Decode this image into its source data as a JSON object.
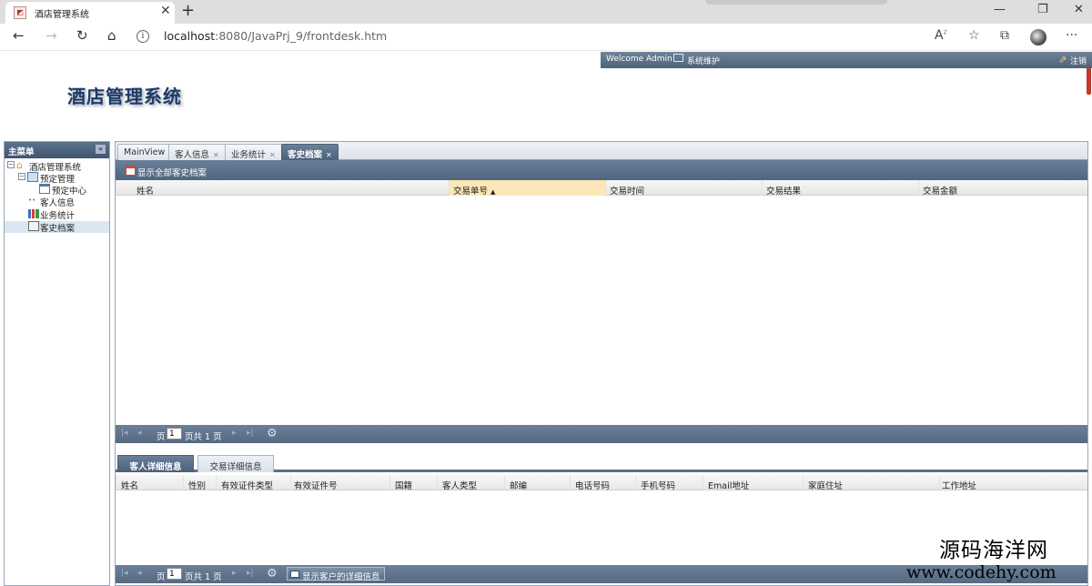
{
  "browser": {
    "tab_title": "酒店管理系统",
    "tab_close": "✕",
    "new_tab": "+",
    "url_host": "localhost",
    "url_path": ":8080/JavaPrj_9/frontdesk.htm",
    "more": "···"
  },
  "header": {
    "welcome": "Welcome Admin",
    "maintenance": "系统维护",
    "logout": "注销",
    "app_title": "酒店管理系统"
  },
  "sidebar": {
    "title": "主菜单",
    "items": [
      {
        "label": "酒店管理系统"
      },
      {
        "label": "预定管理"
      },
      {
        "label": "预定中心"
      },
      {
        "label": "客人信息"
      },
      {
        "label": "业务统计"
      },
      {
        "label": "客史档案"
      }
    ]
  },
  "main": {
    "tabs": [
      {
        "label": "MainView"
      },
      {
        "label": "客人信息"
      },
      {
        "label": "业务统计"
      },
      {
        "label": "客史档案"
      }
    ],
    "toolbar_button": "显示全部客史档案",
    "columns": [
      "姓名",
      "交易单号",
      "交易时间",
      "交易结果",
      "交易金额"
    ],
    "sort_indicator": "▲",
    "pager": {
      "page_label": "页",
      "page_value": "1",
      "total_label": "页共 1 页"
    }
  },
  "detail": {
    "tabs": [
      {
        "label": "客人详细信息"
      },
      {
        "label": "交易详细信息"
      }
    ],
    "columns": [
      "姓名",
      "性别",
      "有效证件类型",
      "有效证件号",
      "国籍",
      "客人类型",
      "邮编",
      "电话号码",
      "手机号码",
      "Email地址",
      "家庭住址",
      "工作地址"
    ],
    "pager": {
      "page_label": "页",
      "page_value": "1",
      "total_label": "页共 1 页",
      "detail_button": "显示客户的详细信息"
    }
  },
  "watermark": {
    "line1": "源码海洋网",
    "line2": "www.codehy.com"
  }
}
